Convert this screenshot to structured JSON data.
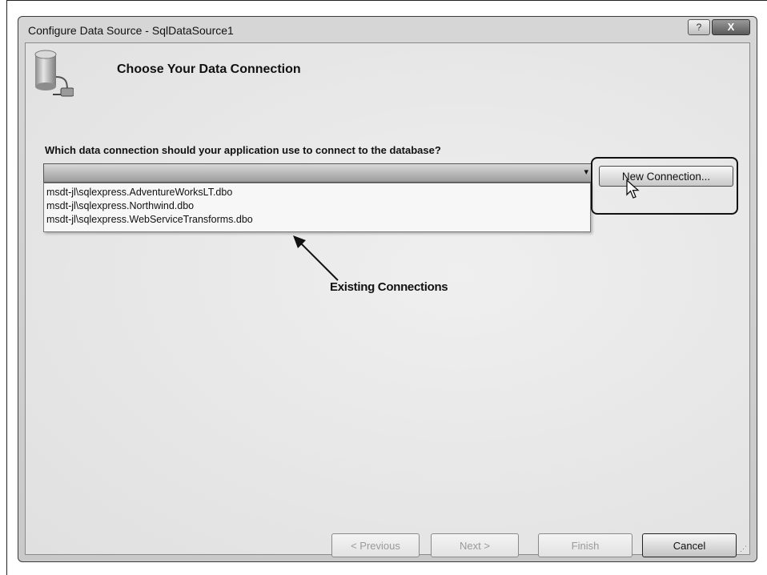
{
  "window": {
    "title": "Configure Data Source - SqlDataSource1",
    "help_label": "?",
    "close_label": "X"
  },
  "header": {
    "heading": "Choose Your Data Connection"
  },
  "form": {
    "question": "Which data connection should your application use to connect to the database?",
    "combo_value": "",
    "combo_arrow": "▾",
    "new_connection_label": "New Connection...",
    "connections": [
      "msdt-jl\\sqlexpress.AdventureWorksLT.dbo",
      "msdt-jl\\sqlexpress.Northwind.dbo",
      "msdt-jl\\sqlexpress.WebServiceTransforms.dbo"
    ]
  },
  "annotation": {
    "label": "Existing Connections"
  },
  "footer": {
    "previous_label": "< Previous",
    "next_label": "Next >",
    "finish_label": "Finish",
    "cancel_label": "Cancel"
  },
  "icons": {
    "database": "database-plug-icon",
    "cursor": "mouse-pointer-icon"
  }
}
